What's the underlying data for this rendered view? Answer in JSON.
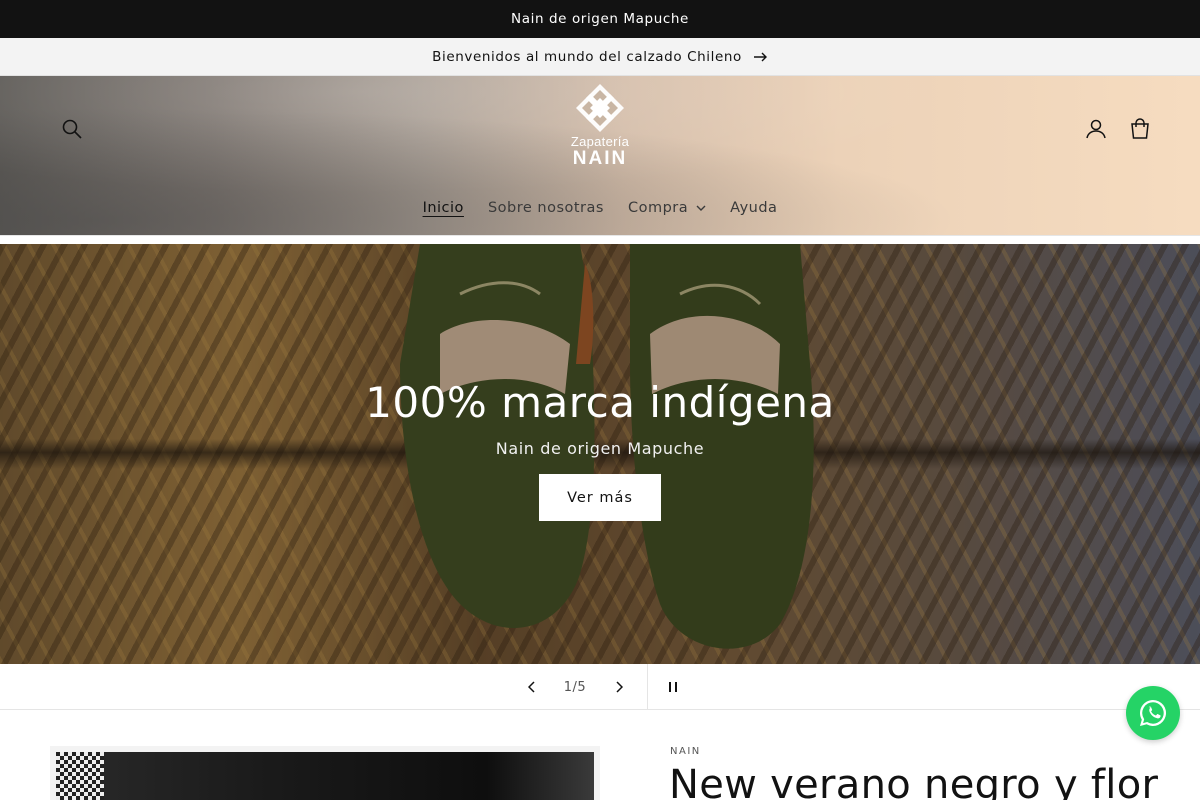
{
  "topbar": {
    "text": "Nain de origen Mapuche"
  },
  "announcement": {
    "text": "Bienvenidos al mundo del calzado Chileno"
  },
  "header": {
    "logo_line1": "Zapatería",
    "logo_line2": "NAIN",
    "nav": [
      {
        "label": "Inicio",
        "active": true
      },
      {
        "label": "Sobre nosotras"
      },
      {
        "label": "Compra",
        "has_dropdown": true
      },
      {
        "label": "Ayuda"
      }
    ],
    "icons": [
      "search-icon",
      "account-icon",
      "cart-icon"
    ]
  },
  "hero": {
    "title": "100% marca indígena",
    "subtitle": "Nain de origen Mapuche",
    "cta": "Ver más"
  },
  "slideshow": {
    "counter": "1/5"
  },
  "product": {
    "vendor": "NAIN",
    "title": "New verano negro y flor"
  },
  "colors": {
    "topbar": "#121212",
    "whatsapp": "#25d366",
    "announcement_bg": "#f3f3f3"
  }
}
